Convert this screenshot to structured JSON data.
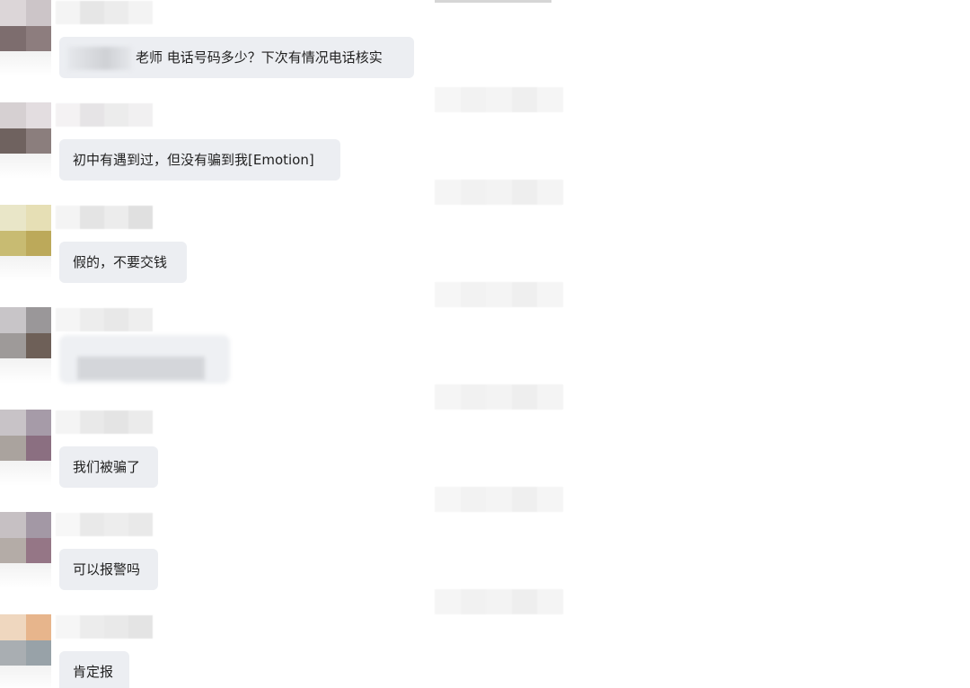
{
  "messages": [
    {
      "text": "老师 电话号码多少？下次有情况电话核实",
      "text_visible": true,
      "prefix_masked": true
    },
    {
      "text": "初中有遇到过，但没有骗到我[Emotion]",
      "text_visible": true,
      "prefix_masked": false
    },
    {
      "text": "假的，不要交钱",
      "text_visible": true,
      "prefix_masked": false
    },
    {
      "text": "",
      "text_visible": false,
      "prefix_masked": false
    },
    {
      "text": "我们被骗了",
      "text_visible": true,
      "prefix_masked": false
    },
    {
      "text": "可以报警吗",
      "text_visible": true,
      "prefix_masked": false
    },
    {
      "text": "肯定报",
      "text_visible": true,
      "prefix_masked": false
    }
  ],
  "masking": {
    "avatars_pixelated": true,
    "usernames_pixelated": true,
    "timestamps_pixelated": true
  },
  "colors": {
    "background": "#ffffff",
    "bubble": "#eceef2",
    "text": "#1f1f1f"
  }
}
